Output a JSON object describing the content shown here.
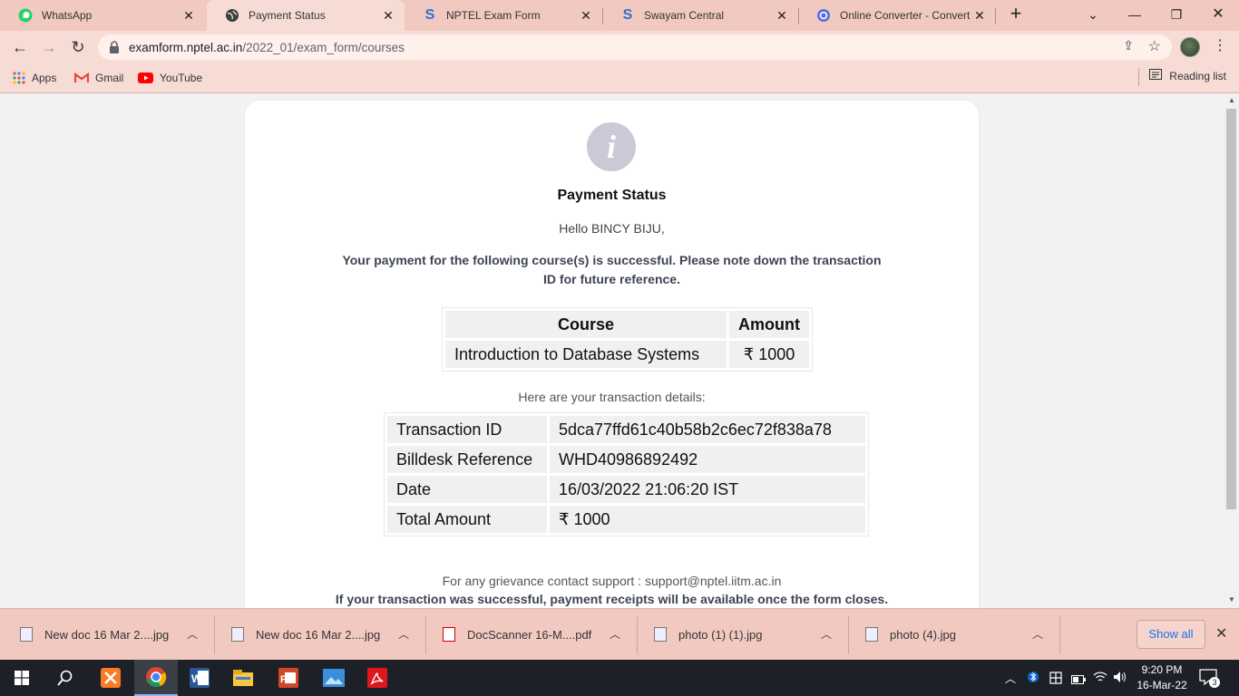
{
  "browser": {
    "tabs": [
      {
        "title": "WhatsApp",
        "icon": "whatsapp-icon"
      },
      {
        "title": "Payment Status",
        "icon": "globe-icon",
        "active": true
      },
      {
        "title": "NPTEL Exam Form",
        "icon": "swayam-icon"
      },
      {
        "title": "Swayam Central",
        "icon": "swayam-icon"
      },
      {
        "title": "Online Converter - Convert Im",
        "icon": "converter-icon"
      }
    ],
    "url_domain": "examform.nptel.ac.in",
    "url_path": "/2022_01/exam_form/courses",
    "bookmarks": [
      {
        "label": "Apps",
        "icon": "apps-grid-icon"
      },
      {
        "label": "Gmail",
        "icon": "gmail-icon"
      },
      {
        "label": "YouTube",
        "icon": "youtube-icon"
      }
    ],
    "reading_list": "Reading list"
  },
  "page": {
    "heading": "Payment Status",
    "greeting": "Hello BINCY BIJU,",
    "success_message": "Your payment for the following course(s) is successful. Please note down the transaction ID for future reference.",
    "course_table": {
      "headers": [
        "Course",
        "Amount"
      ],
      "rows": [
        [
          "Introduction to Database Systems",
          "₹ 1000"
        ]
      ]
    },
    "transaction_intro": "Here are your transaction details:",
    "transaction_table": [
      [
        "Transaction ID",
        "5dca77ffd61c40b58b2c6ec72f838a78"
      ],
      [
        "Billdesk Reference",
        "WHD40986892492"
      ],
      [
        "Date",
        "16/03/2022 21:06:20 IST"
      ],
      [
        "Total Amount",
        "₹ 1000"
      ]
    ],
    "grievance": "For any grievance contact support : support@nptel.iitm.ac.in",
    "receipt_note": "If your transaction was successful, payment receipts will be available once the form closes."
  },
  "downloads": {
    "items": [
      {
        "name": "New doc 16 Mar 2....jpg",
        "type": "image"
      },
      {
        "name": "New doc 16 Mar 2....jpg",
        "type": "image"
      },
      {
        "name": "DocScanner 16-M....pdf",
        "type": "pdf"
      },
      {
        "name": "photo (1) (1).jpg",
        "type": "image"
      },
      {
        "name": "photo (4).jpg",
        "type": "image"
      }
    ],
    "show_all": "Show all"
  },
  "taskbar": {
    "time": "9:20 PM",
    "date": "16-Mar-22",
    "notification_count": "3"
  },
  "colors": {
    "chrome_frame": "#f2c9c0",
    "chrome_toolbar": "#f7dcd6",
    "info_icon": "#c9cad6",
    "link_blue": "#1a73e8"
  }
}
